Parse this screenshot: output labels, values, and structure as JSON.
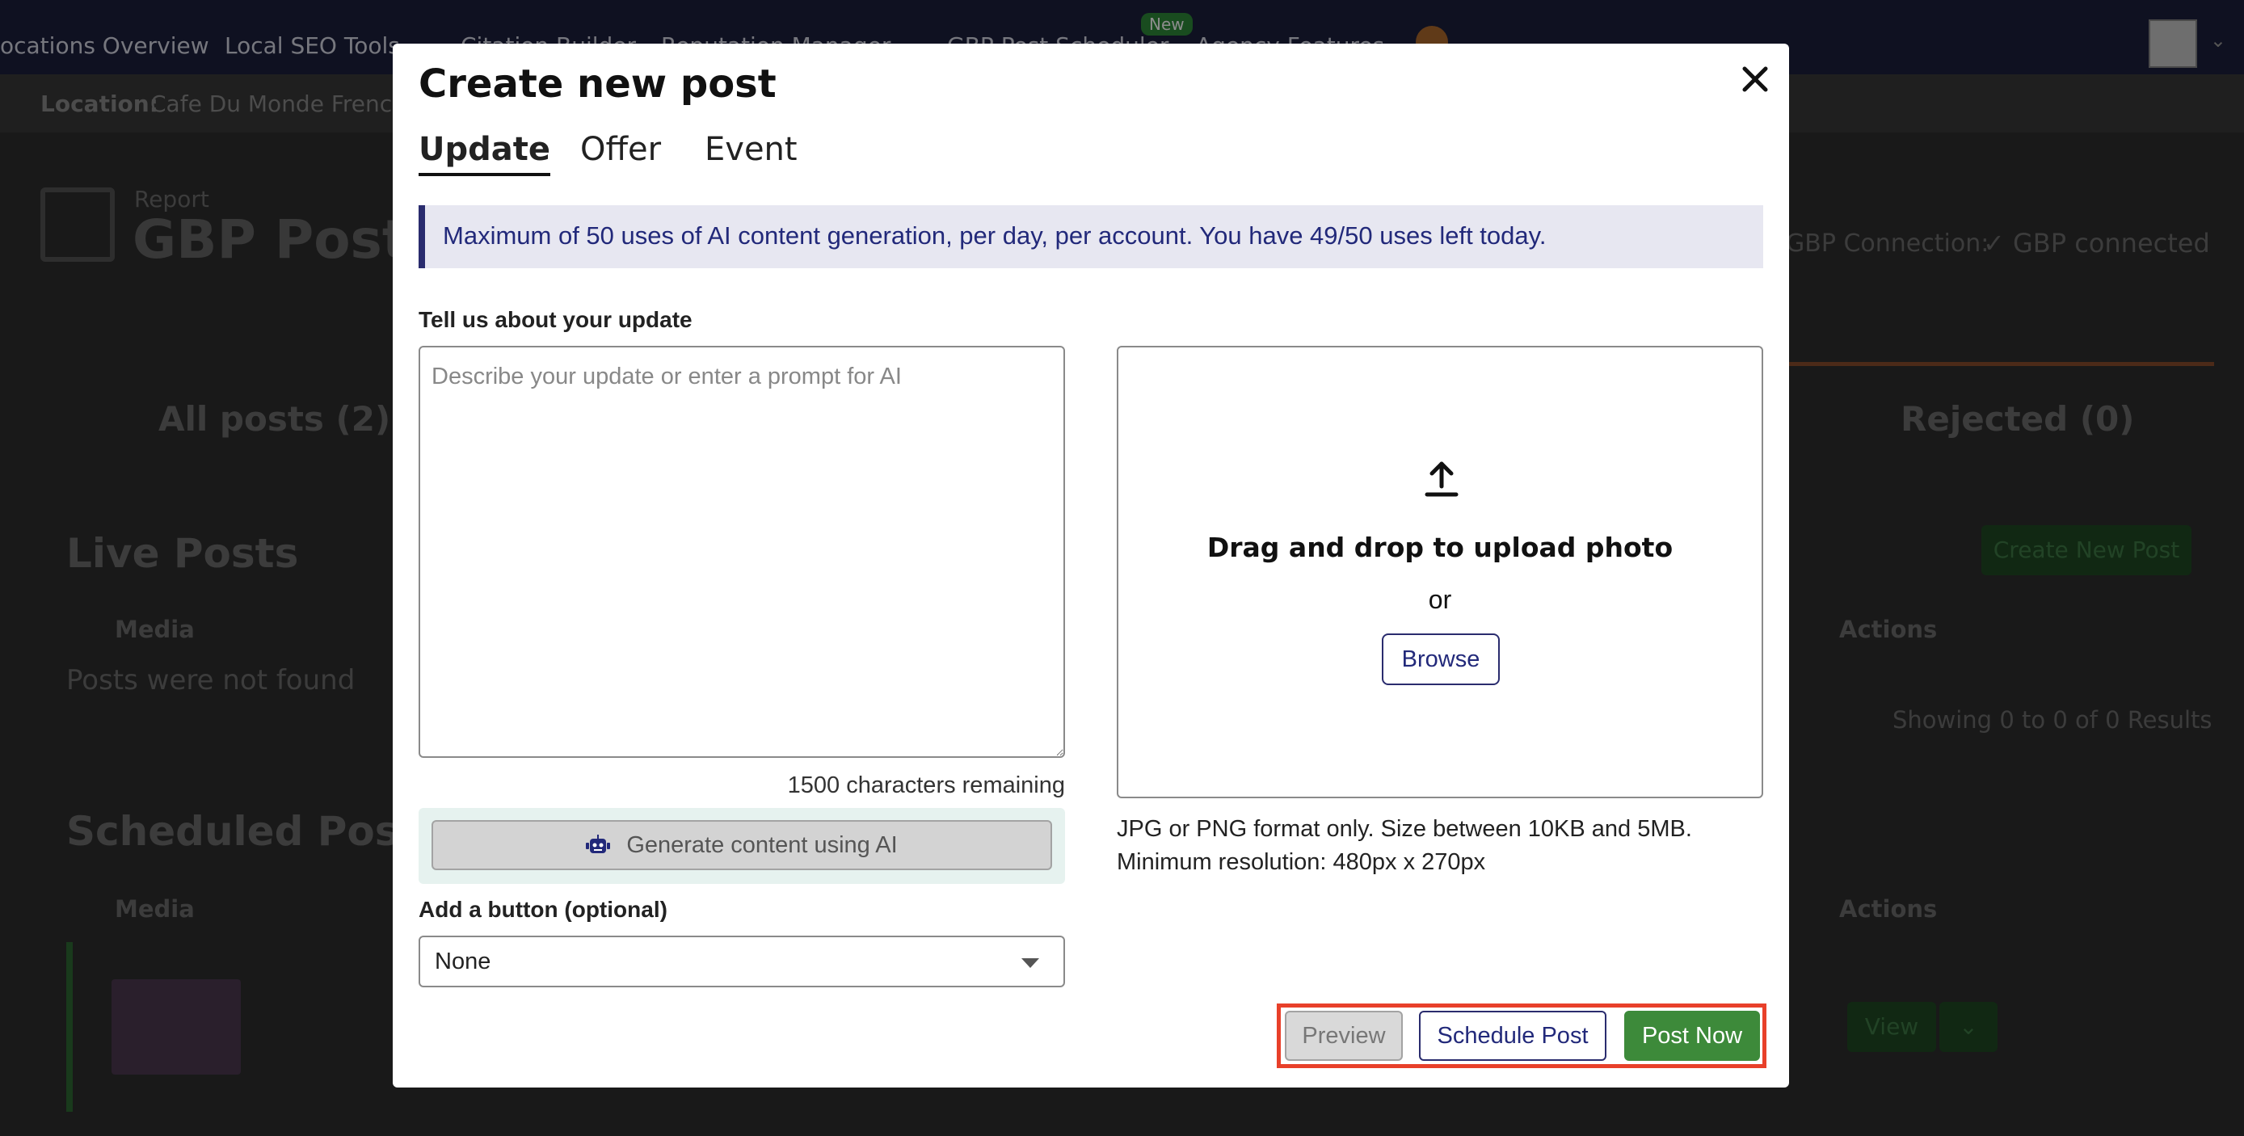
{
  "nav": {
    "items": [
      "ocations Overview",
      "Local SEO Tools",
      "Citation Builder",
      "Reputation Manager",
      "GBP Post Scheduler",
      "Agency Features"
    ],
    "new_badge": "New"
  },
  "background": {
    "location_label": "Location:",
    "location_value": "Cafe Du Monde French",
    "report_label": "Report",
    "report_title": "GBP Post S",
    "gbp_connection_label": "GBP Connection:",
    "gbp_connection_value": "✓ GBP connected",
    "tab_all_posts": "All posts (2)",
    "tab_rejected": "Rejected (0)",
    "live_posts_heading": "Live Posts",
    "create_new_post": "Create New Post",
    "media_col": "Media",
    "actions_col": "Actions",
    "not_found": "Posts were not found",
    "showing": "Showing 0 to 0 of 0 Results",
    "scheduled_heading": "Scheduled Posts",
    "view_btn": "View"
  },
  "modal": {
    "title": "Create new post",
    "tabs": [
      {
        "label": "Update",
        "active": true
      },
      {
        "label": "Offer",
        "active": false
      },
      {
        "label": "Event",
        "active": false
      }
    ],
    "banner": "Maximum of 50 uses of AI content generation, per day, per account. You have 49/50 uses left today.",
    "prompt_label": "Tell us about your update",
    "prompt_placeholder": "Describe your update or enter a prompt for AI",
    "chars_remaining": "1500 characters remaining",
    "generate_label": "Generate content using AI",
    "button_label": "Add a button (optional)",
    "button_selected": "None",
    "upload": {
      "drag_text": "Drag and drop to upload photo",
      "or_text": "or",
      "browse_label": "Browse"
    },
    "hint_line1": "JPG or PNG format only. Size between 10KB and 5MB.",
    "hint_line2": "Minimum resolution: 480px x 270px",
    "actions": {
      "preview": "Preview",
      "schedule": "Schedule Post",
      "post_now": "Post Now"
    }
  },
  "colors": {
    "accent_navy": "#22297a",
    "post_now_green": "#3d8a3a",
    "highlight_red": "#e8402a"
  }
}
